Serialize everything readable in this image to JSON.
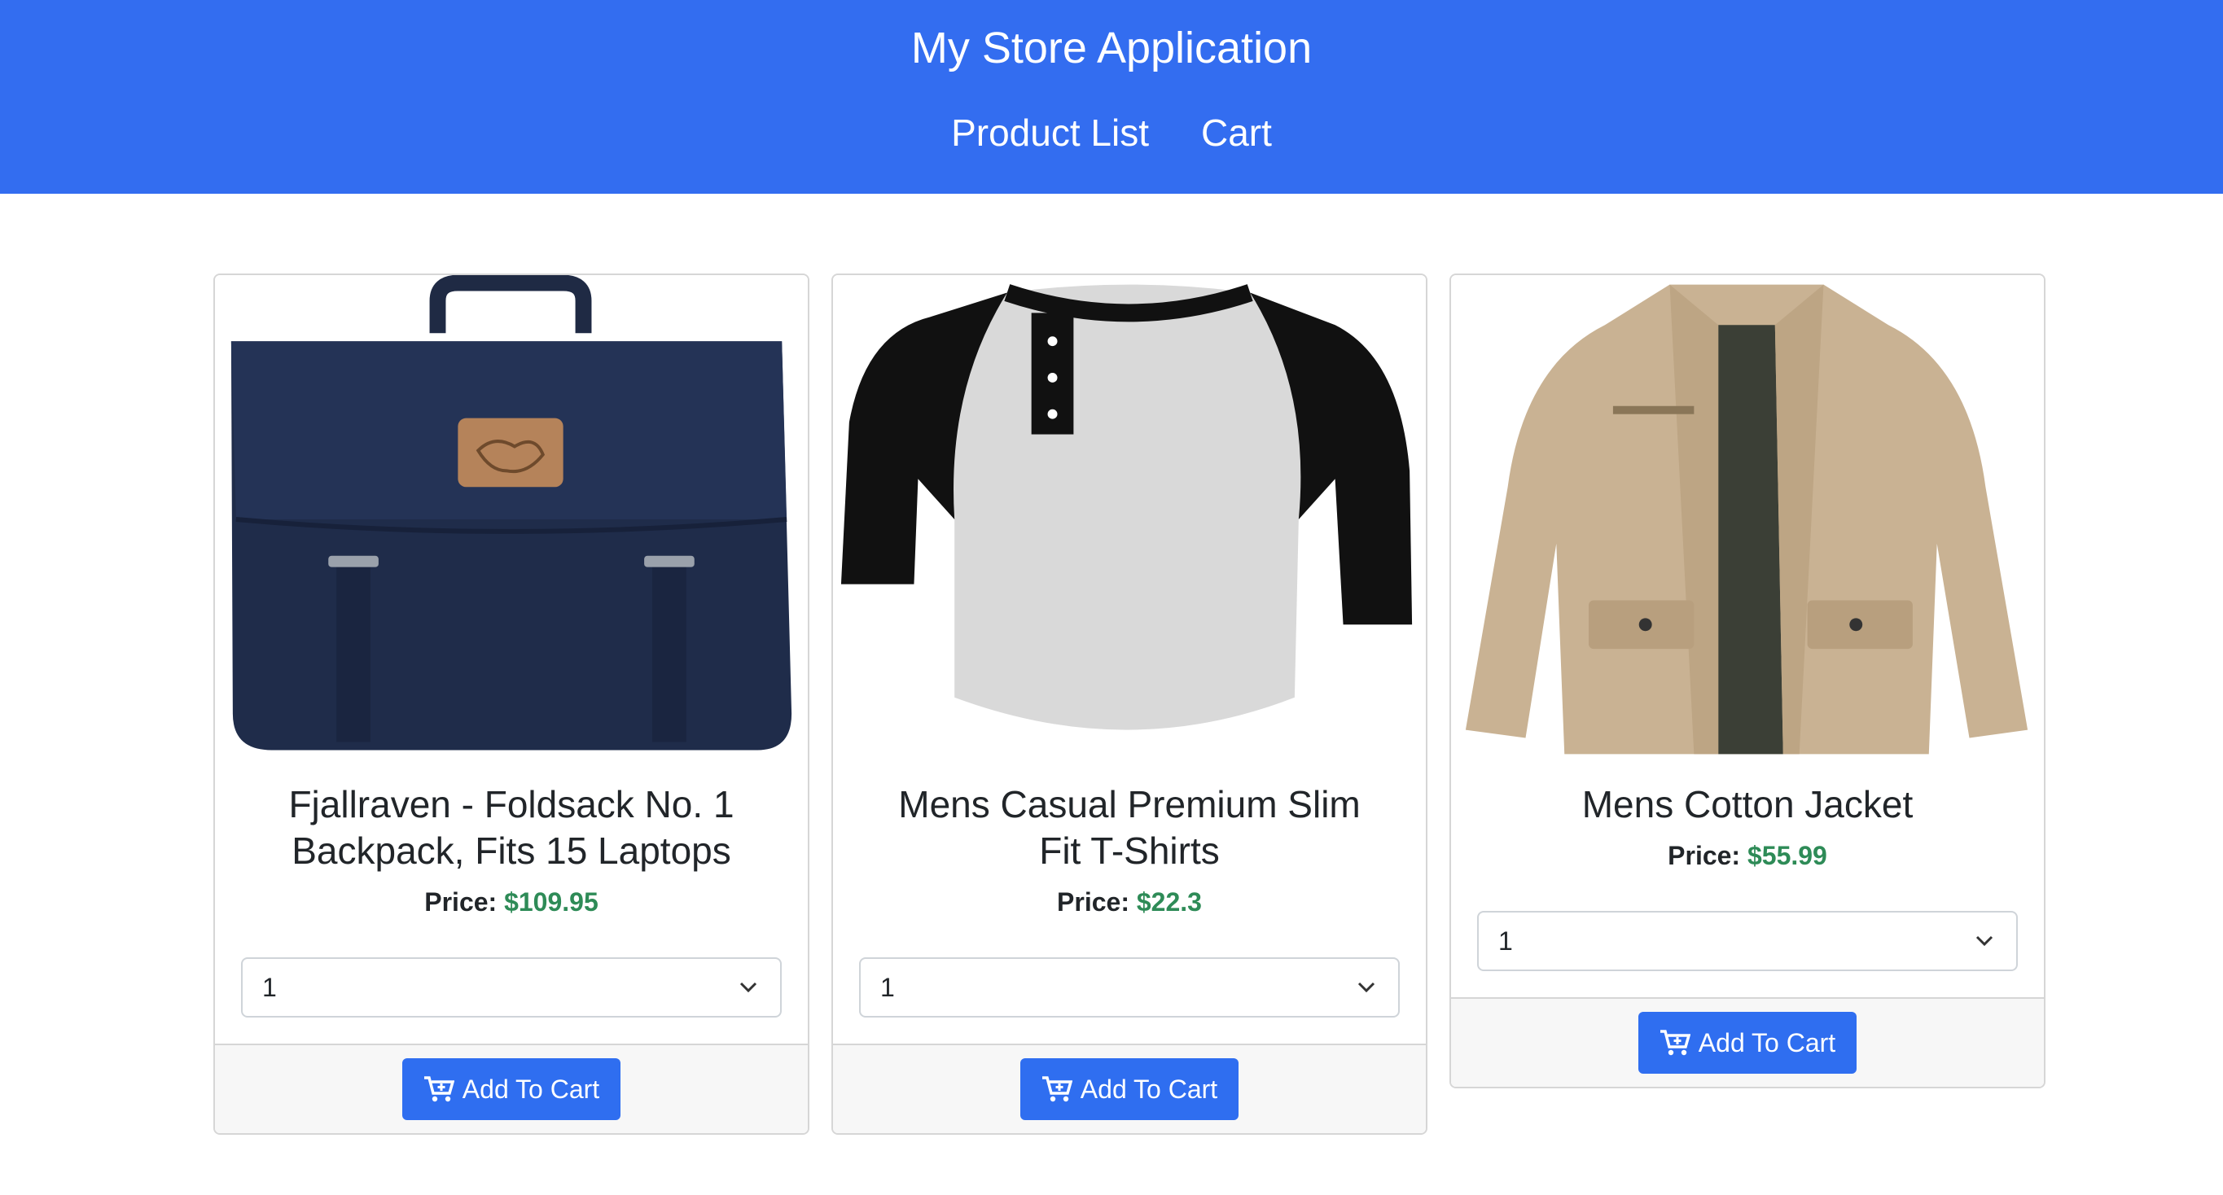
{
  "navbar": {
    "title": "My Store Application",
    "links": [
      {
        "label": "Product List"
      },
      {
        "label": "Cart"
      }
    ]
  },
  "products": [
    {
      "name": "Fjallraven - Foldsack No. 1 Backpack, Fits 15 Laptops",
      "price_label": "Price:",
      "price": "$109.95",
      "quantity": "1",
      "button_label": "Add To Cart",
      "image_icon": "backpack-image"
    },
    {
      "name": "Mens Casual Premium Slim Fit T-Shirts",
      "price_label": "Price:",
      "price": "$22.3",
      "quantity": "1",
      "button_label": "Add To Cart",
      "image_icon": "tshirt-image"
    },
    {
      "name": "Mens Cotton Jacket",
      "price_label": "Price:",
      "price": "$55.99",
      "quantity": "1",
      "button_label": "Add To Cart",
      "image_icon": "jacket-image"
    }
  ],
  "colors": {
    "navbar": "#336df0",
    "button": "#2f6ef0",
    "price": "#2e8b57"
  }
}
